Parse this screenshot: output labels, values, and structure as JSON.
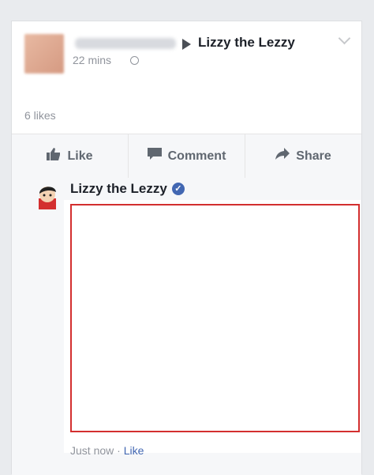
{
  "post": {
    "page_name": "Lizzy the Lezzy",
    "time": "22 mins",
    "text": "",
    "likes": "6 likes"
  },
  "actions": {
    "like": "Like",
    "comment": "Comment",
    "share": "Share"
  },
  "comment": {
    "author": "Lizzy the Lezzy",
    "verified_mark": "✓",
    "time": "Just now",
    "separator": "·",
    "like": "Like"
  },
  "colors": {
    "brand_blue": "#4267b2",
    "highlight_border": "#d32f2f",
    "muted_text": "#90949c"
  }
}
